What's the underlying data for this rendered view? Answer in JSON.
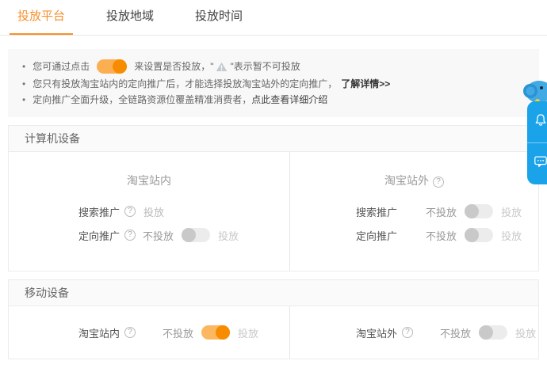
{
  "tabs": [
    {
      "label": "投放平台",
      "active": true
    },
    {
      "label": "投放地域",
      "active": false
    },
    {
      "label": "投放时间",
      "active": false
    }
  ],
  "notice": {
    "bullet": "•",
    "line1_before": "您可通过点击",
    "line1_after": "来设置是否投放，\"",
    "line1_warn_suffix": "\"表示暂不可投放",
    "line2_text": "您只有投放淘宝站内的定向推广后，才能选择投放淘宝站外的定向推广，",
    "line2_link": "了解详情>>",
    "line3_text": "定向推广全面升级，全链路资源位覆盖精准消费者，",
    "line3_link": "点此查看详细介绍"
  },
  "icons": {
    "help_glyph": "?"
  },
  "sections": {
    "computer": {
      "title": "计算机设备",
      "onsite": {
        "header": "淘宝站内",
        "rows": [
          {
            "label": "搜索推广",
            "value": "投放"
          },
          {
            "label": "定向推广",
            "off": "不投放",
            "on": "投放",
            "state": "off"
          }
        ]
      },
      "offsite": {
        "header": "淘宝站外",
        "rows": [
          {
            "label": "搜索推广",
            "off": "不投放",
            "on": "投放",
            "state": "off"
          },
          {
            "label": "定向推广",
            "off": "不投放",
            "on": "投放",
            "state": "off"
          }
        ]
      }
    },
    "mobile": {
      "title": "移动设备",
      "onsite": {
        "label": "淘宝站内",
        "off": "不投放",
        "on": "投放",
        "state": "on"
      },
      "offsite": {
        "label": "淘宝站外",
        "off": "不投放",
        "on": "投放",
        "state": "off"
      }
    }
  },
  "colors": {
    "accent_orange": "#f8902c",
    "toggle_knob_on": "#f78c00",
    "toggle_track_on": "#fcb860",
    "toggle_track_off": "#ececec",
    "toggle_knob_off": "#c9c9c9",
    "notice_bg": "#f8f8f8",
    "widget_blue": "#1aa3e8"
  }
}
